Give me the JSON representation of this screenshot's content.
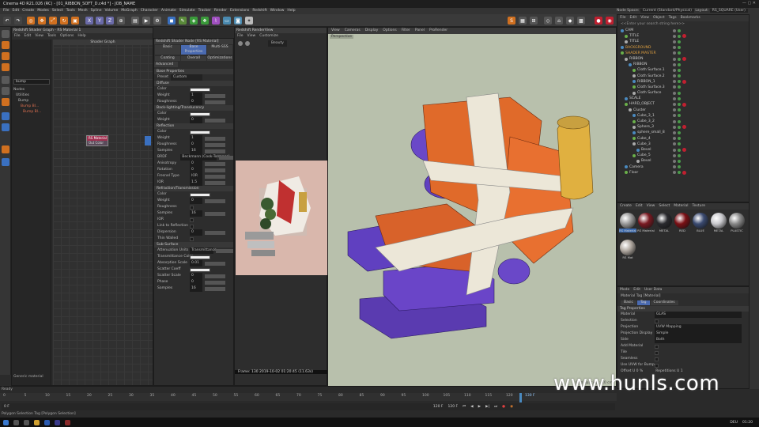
{
  "window": {
    "title": "Cinema 4D R21.026 (RC) - [01_RIBBON_SOFT_D.c4d *] - JOB_NAME"
  },
  "menu": [
    "File",
    "Edit",
    "Create",
    "Modes",
    "Select",
    "Tools",
    "Mesh",
    "Spline",
    "Volume",
    "MoGraph",
    "Character",
    "Animate",
    "Simulate",
    "Tracker",
    "Render",
    "Extensions",
    "Redshift",
    "Window",
    "Help"
  ],
  "node_space": {
    "label": "Node Space:",
    "value": "Current (Standard/Physical)",
    "layout_label": "Layout:",
    "layout_value": "RS_SQUARE (User)"
  },
  "toolbar": {
    "x": "X",
    "y": "Y",
    "z": "Z"
  },
  "shader_graph": {
    "title": "Redshift Shader Graph - RS Material 1",
    "menu": [
      "File",
      "Edit",
      "View",
      "Tools",
      "Options",
      "Help"
    ],
    "header": "Shader Graph",
    "search": "bump",
    "tree": [
      "Nodes",
      "Utilities",
      "Bump",
      "Bump Bl...",
      "Bump Bl..."
    ],
    "node_title": "RS Material",
    "node_port": "Out Color",
    "footer": "Generic material"
  },
  "props": {
    "title": "Redshift Shader Node [RS Material]",
    "tabs1": [
      "Basic",
      "Base Properties",
      "Multi-SSS"
    ],
    "tabs2": [
      "Coating",
      "Overall",
      "Optimizations"
    ],
    "tab3": "Advanced",
    "base_header": "Base Properties",
    "preset_label": "Preset",
    "preset_value": "Custom",
    "diffuse": {
      "header": "Diffuse",
      "rows": [
        {
          "label": "Color",
          "value": ""
        },
        {
          "label": "Weight",
          "value": "1"
        },
        {
          "label": "Roughness",
          "value": "0"
        }
      ]
    },
    "backlight": {
      "header": "Back-lighting/Translucency",
      "rows": [
        {
          "label": "Color",
          "value": ""
        },
        {
          "label": "Weight",
          "value": "0"
        }
      ]
    },
    "reflection": {
      "header": "Reflection",
      "rows": [
        {
          "label": "Color",
          "value": ""
        },
        {
          "label": "Weight",
          "value": "1"
        },
        {
          "label": "Roughness",
          "value": "0"
        },
        {
          "label": "Samples",
          "value": "16"
        },
        {
          "label": "BRDF",
          "value": "Beckmann (Cook-Torrance)"
        },
        {
          "label": "Anisotropy",
          "value": "0"
        },
        {
          "label": "Rotation",
          "value": "0"
        },
        {
          "label": "Fresnel Type",
          "value": "IOR"
        },
        {
          "label": "IOR",
          "value": "1.5"
        }
      ]
    },
    "refraction": {
      "header": "Refraction/Transmission",
      "rows": [
        {
          "label": "Color",
          "value": ""
        },
        {
          "label": "Weight",
          "value": "0"
        },
        {
          "label": "Roughness",
          "value": ""
        },
        {
          "label": "Samples",
          "value": "16"
        },
        {
          "label": "IOR",
          "value": ""
        },
        {
          "label": "Link to Reflection",
          "value": ""
        },
        {
          "label": "Dispersion",
          "value": "0"
        },
        {
          "label": "Thin Walled",
          "value": ""
        }
      ]
    },
    "sss": {
      "header": "Sub-Surface",
      "rows": [
        {
          "label": "Attenuation Units",
          "value": "Transmittance"
        },
        {
          "label": "Transmittance Color",
          "value": ""
        },
        {
          "label": "Absorption Scale",
          "value": "0.01"
        },
        {
          "label": "Scatter Coeff",
          "value": ""
        },
        {
          "label": "Scatter Scale",
          "value": "0"
        },
        {
          "label": "Phase",
          "value": "0"
        },
        {
          "label": "Samples",
          "value": "16"
        }
      ]
    }
  },
  "renderview": {
    "title": "Redshift RenderView",
    "menu": [
      "File",
      "View",
      "Customize"
    ],
    "beauty": "Beauty",
    "frame_info": "Frame: 130  2019-10-02  01:20:45  (11.63s)",
    "progress": "Progressive Rendering..."
  },
  "viewport": {
    "menu": [
      "View",
      "Cameras",
      "Display",
      "Options",
      "Filter",
      "Panel",
      "ProRender"
    ],
    "label": "Perspective",
    "grid": "Grid Spacing : 10 cm"
  },
  "objects": {
    "menu": [
      "File",
      "Edit",
      "View",
      "Object",
      "Tags",
      "Bookmarks"
    ],
    "search": "<<Enter your search string here>>",
    "items": [
      "CAM",
      "TITLE",
      "TITLE",
      "BACKGROUND",
      "SHADER MASTER",
      "RIBBON",
      "RIBBON",
      "Cloth Surface.1",
      "Cloth Surface.2",
      "RIBBON_1",
      "Cloth Surface.3",
      "Cloth Surface",
      "SCALE",
      "HARD_OBJECT",
      "Cluster",
      "Cube_3_1",
      "Cube_3_2",
      "Sphere_3",
      "sphere_small_8",
      "Cube_4",
      "Cube_3",
      "Bevel",
      "Cube_5",
      "Bevel",
      "Camera",
      "Floor"
    ]
  },
  "materials": {
    "menu": [
      "Create",
      "Edit",
      "View",
      "Select",
      "Material",
      "Texture"
    ],
    "items": [
      {
        "name": "RS Material",
        "color": "#9a9a9a"
      },
      {
        "name": "RS Material",
        "color": "#7a1a22"
      },
      {
        "name": "METAL",
        "color": "#2a2a2e"
      },
      {
        "name": "RED",
        "color": "#7a1015"
      },
      {
        "name": "BLUE",
        "color": "#3a4a70"
      },
      {
        "name": "METAL",
        "color": "#c8c8cc"
      },
      {
        "name": "PLASTIC",
        "color": "#888"
      },
      {
        "name": "RS Mat",
        "color": "#b0a8a0"
      }
    ]
  },
  "attributes": {
    "menu": [
      "Mode",
      "Edit",
      "User Data"
    ],
    "title": "Material Tag [Material]",
    "tabs": [
      "Basic",
      "Tag",
      "Coordinates"
    ],
    "section": "Tag Properties",
    "rows": [
      {
        "label": "Material",
        "value": "GLAS"
      },
      {
        "label": "Selection",
        "value": ""
      },
      {
        "label": "Projection",
        "value": "UVW Mapping"
      },
      {
        "label": "Projection Display",
        "value": "Simple"
      },
      {
        "label": "Side",
        "value": "Both"
      },
      {
        "label": "Add Material",
        "value": ""
      },
      {
        "label": "Tile",
        "value": ""
      },
      {
        "label": "Seamless",
        "value": ""
      },
      {
        "label": "Use UVW for Bump",
        "value": ""
      }
    ],
    "offset": "Offset U 0 %",
    "repetitions": "Repetitions U 1"
  },
  "timeline": {
    "ticks": [
      "0",
      "5",
      "10",
      "15",
      "20",
      "25",
      "30",
      "35",
      "40",
      "45",
      "50",
      "55",
      "60",
      "65",
      "70",
      "75",
      "80",
      "85",
      "90",
      "95",
      "100",
      "105",
      "110",
      "115",
      "120"
    ],
    "current": "130 F",
    "start": "0 F",
    "end": "120 F",
    "fps": "120 F"
  },
  "status": {
    "ready": "Ready",
    "bottom": "Polygon Selection Tag [Polygon Selection]"
  },
  "taskbar": {
    "time": "01:20",
    "lang": "DEU"
  },
  "watermark": "www.hunls.com"
}
